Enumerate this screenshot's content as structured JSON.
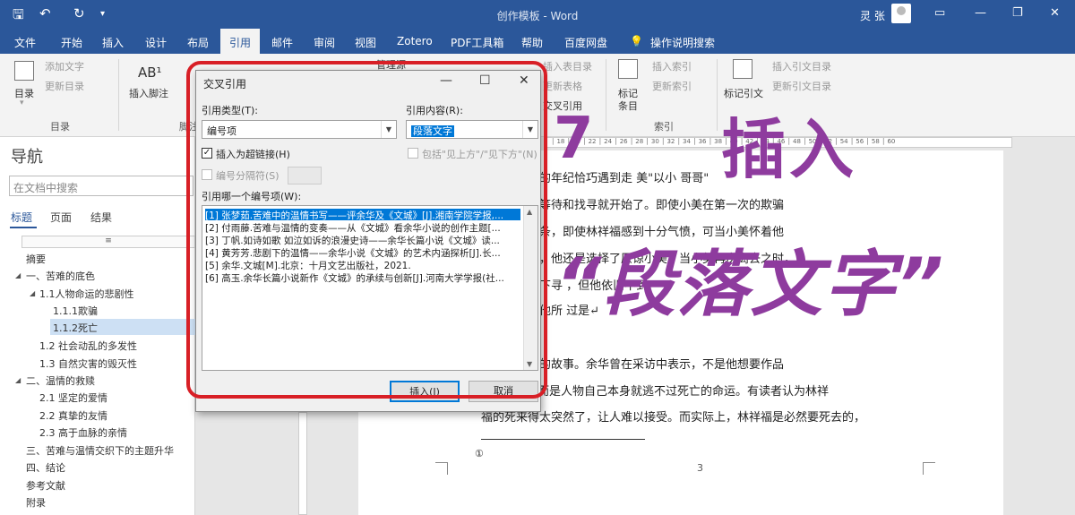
{
  "window": {
    "title": "创作模板 - Word",
    "user": "灵 张",
    "quick_access": [
      "save-icon",
      "undo-icon",
      "redo-icon",
      "customize-icon"
    ]
  },
  "tabs": [
    "文件",
    "开始",
    "插入",
    "设计",
    "布局",
    "引用",
    "邮件",
    "审阅",
    "视图",
    "Zotero",
    "PDF工具箱",
    "帮助",
    "百度网盘",
    "操作说明搜索"
  ],
  "active_tab": "引用",
  "ribbon": {
    "toc": {
      "button": "目录",
      "add_text": "添加文字",
      "update_toc": "更新目录",
      "group": "目录"
    },
    "footnotes": {
      "insert_footnote": "插入脚注",
      "group": "脚注"
    },
    "citations": {
      "manage_sources": "管理源"
    },
    "captions": {
      "insert_table_of_figures": "插入表目录",
      "update_table": "更新表格",
      "cross_reference": "交叉引用"
    },
    "index": {
      "mark_entry": "标记",
      "mark_entry2": "条目",
      "insert_index": "插入索引",
      "update_index": "更新索引",
      "group": "索引"
    },
    "authorities": {
      "mark_citation": "标记引文",
      "insert_toa": "插入引文目录",
      "update_toa": "更新引文目录"
    }
  },
  "nav": {
    "title": "导航",
    "search_placeholder": "在文档中搜索",
    "tabs": [
      "标题",
      "页面",
      "结果"
    ],
    "items": [
      {
        "label": "摘要",
        "level": 0,
        "selected": false
      },
      {
        "label": "一、苦难的底色",
        "level": 0,
        "selected": false
      },
      {
        "label": "1.1人物命运的悲剧性",
        "level": 1,
        "selected": false
      },
      {
        "label": "1.1.1欺骗",
        "level": 2,
        "selected": false
      },
      {
        "label": "1.1.2死亡",
        "level": 2,
        "selected": true
      },
      {
        "label": "1.2 社会动乱的多发性",
        "level": 1,
        "selected": false
      },
      {
        "label": "1.3 自然灾害的毁灭性",
        "level": 1,
        "selected": false
      },
      {
        "label": "二、温情的救赎",
        "level": 0,
        "selected": false
      },
      {
        "label": "2.1 坚定的爱情",
        "level": 1,
        "selected": false
      },
      {
        "label": "2.2 真挚的友情",
        "level": 1,
        "selected": false
      },
      {
        "label": "2.3 高于血脉的亲情",
        "level": 1,
        "selected": false
      },
      {
        "label": "三、苦难与温情交织下的主题升华",
        "level": 0,
        "selected": false
      },
      {
        "label": "四、结论",
        "level": 0,
        "selected": false
      },
      {
        "label": "参考文献",
        "level": 0,
        "selected": false
      },
      {
        "label": "附录",
        "level": 0,
        "selected": false
      }
    ]
  },
  "dialog": {
    "title": "交叉引用",
    "ref_type_label": "引用类型(T):",
    "ref_type_value": "编号项",
    "ref_content_label": "引用内容(R):",
    "ref_content_value": "段落文字",
    "insert_hyperlink": "插入为超链接(H)",
    "insert_hyperlink_checked": true,
    "include_above_below": "包括\"见上方\"/\"见下方\"(N)",
    "separate_numbers": "编号分隔符(S)",
    "which_item_label": "引用哪一个编号项(W):",
    "items": [
      "[1] 张梦茹.苦难中的温情书写——评余华及《文城》[J].湘南学院学报,...",
      "[2] 付雨藤.苦难与温情的变奏——从《文城》看余华小说的创作主题[...",
      "[3] 丁帆.如诗如歌 如泣如诉的浪漫史诗——余华长篇小说《文城》读...",
      "[4] 黄芳芳.悲剧下的温情——余华小说《文城》的艺术内涵探析[J].长...",
      "[5] 余华.文城[M].北京：十月文艺出版社，2021.",
      "[6] 高玉.余华长篇小说新作《文城》的承续与创新[J].河南大学学报(社..."
    ],
    "selected_index": 0,
    "insert_button": "插入(I)",
    "cancel_button": "取消"
  },
  "doc": {
    "lines": [
      "在富贵结婚的年纪恰巧遇到走              美\"以小            哥哥\"",
      "一场无果的等待和找寻就开始了。即使小美在第一次的欺骗",
      "福大半的金条，即使林祥福感到十分气愤，可当小美怀着他",
      "身边的时候，他还是选择了原谅小美。当小美再次离去之时，",
      "子诺言，南下寻               ，但他依旧不到",
      "存在，因为他所               过是↵",
      "离不开死亡的故事。余华曾在采访中表示，不是他想要作品",
      "而是人物自己本身就逃不过死亡的命运。有读者认为林祥",
      "福的死来得太突然了，让人难以接受。而实际上，林祥福是必然要死去的，"
    ],
    "footnote_mark": "①",
    "page_number": "3"
  },
  "overlay": {
    "step": "7",
    "title1": "插入",
    "title2": "“段落文字”",
    "color": "#8e3b9e"
  },
  "colors": {
    "word_blue": "#2b579a",
    "highlight_red": "#d81f26",
    "select_blue": "#0078d7"
  }
}
